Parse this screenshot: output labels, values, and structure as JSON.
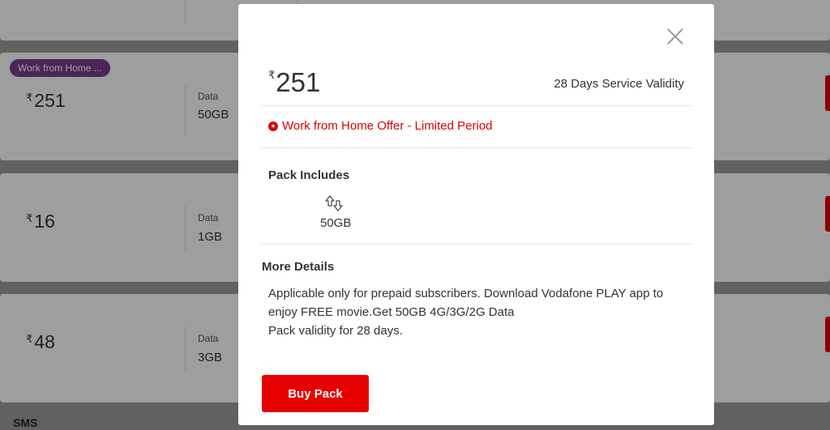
{
  "background": {
    "badge": "Work from Home ...",
    "cards": [
      {
        "price": "251",
        "data_label": "Data",
        "data_value": "50GB"
      },
      {
        "price": "16",
        "data_label": "Data",
        "data_value": "1GB"
      },
      {
        "price": "48",
        "data_label": "Data",
        "data_value": "3GB"
      }
    ],
    "sms_label": "SMS",
    "currency_symbol": "₹"
  },
  "modal": {
    "currency_symbol": "₹",
    "price": "251",
    "validity": "28 Days Service Validity",
    "offer": "Work from Home Offer - Limited Period",
    "pack_includes_title": "Pack Includes",
    "pack_data": "50GB",
    "more_details_title": "More Details",
    "more_details_lines": [
      "Applicable only for prepaid subscribers. Download Vodafone PLAY app to",
      "enjoy FREE movie.Get 50GB 4G/3G/2G Data",
      "Pack validity for 28 days."
    ],
    "buy_label": "Buy Pack",
    "close_icon": "close-icon",
    "data_icon": "data-transfer-icon",
    "offer_icon": "offer-badge-icon"
  },
  "colors": {
    "accent_red": "#e60000",
    "offer_red": "#d00000",
    "badge_purple": "#7a3d8c"
  }
}
